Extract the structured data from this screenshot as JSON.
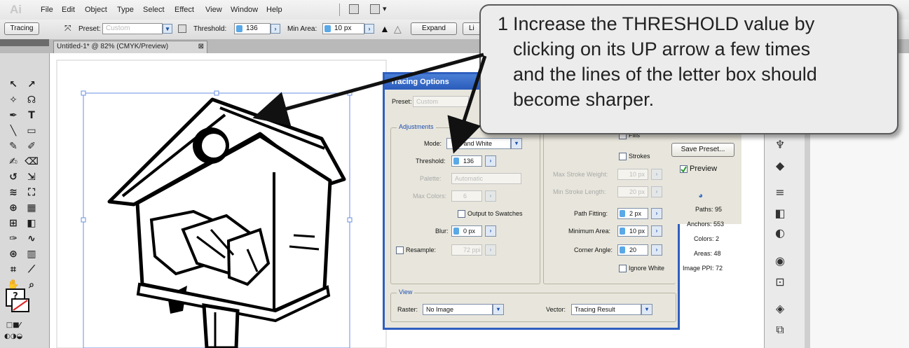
{
  "app": {
    "logo": "Ai"
  },
  "menu": [
    "File",
    "Edit",
    "Object",
    "Type",
    "Select",
    "Effect",
    "View",
    "Window",
    "Help"
  ],
  "controlbar": {
    "mode_label": "Tracing",
    "preset_label": "Preset:",
    "preset_value": "Custom",
    "threshold_label": "Threshold:",
    "threshold_value": "136",
    "min_area_label": "Min Area:",
    "min_area_value": "10 px",
    "expand_button": "Expand",
    "live_button": "Li"
  },
  "document_tab": {
    "title": "Untitled-1* @ 82% (CMYK/Preview)"
  },
  "dialog": {
    "title": "Tracing Options",
    "preset_label": "Preset:",
    "preset_value": "Custom",
    "adjustments_title": "Adjustments",
    "mode_label": "Mode:",
    "mode_value": "ck and White",
    "threshold_label": "Threshold:",
    "threshold_value": "136",
    "palette_label": "Palette:",
    "palette_value": "Automatic",
    "max_colors_label": "Max Colors:",
    "max_colors_value": "6",
    "output_swatches_label": "Output to Swatches",
    "blur_label": "Blur:",
    "blur_value": "0 px",
    "resample_label": "Resample:",
    "resample_value": "72 ppi",
    "fills_label": "Fills",
    "strokes_label": "Strokes",
    "max_stroke_weight_label": "Max Stroke Weight:",
    "max_stroke_weight_value": "10 px",
    "min_stroke_length_label": "Min Stroke Length:",
    "min_stroke_length_value": "20 px",
    "path_fitting_label": "Path Fitting:",
    "path_fitting_value": "2 px",
    "minimum_area_label": "Minimum Area:",
    "minimum_area_value": "10 px",
    "corner_angle_label": "Corner Angle:",
    "corner_angle_value": "20",
    "ignore_white_label": "Ignore White",
    "save_preset_button": "Save Preset...",
    "preview_label": "Preview",
    "paths": "Paths: 95",
    "anchors": "Anchors: 553",
    "colors": "Colors: 2",
    "areas": "Areas: 48",
    "image_ppi": "Image PPI: 72",
    "view_title": "View",
    "raster_label": "Raster:",
    "raster_value": "No Image",
    "vector_label": "Vector:",
    "vector_value": "Tracing Result"
  },
  "callout": {
    "number": "1",
    "line1": "Increase the THRESHOLD value by",
    "line2": "clicking on its UP arrow a few times",
    "line3": "and the lines of the letter box should",
    "line4": "become sharper."
  },
  "icons": {
    "spinner": "spinner-icon",
    "arrow": "right-arrow-icon",
    "checkbox": "checkbox-icon"
  }
}
